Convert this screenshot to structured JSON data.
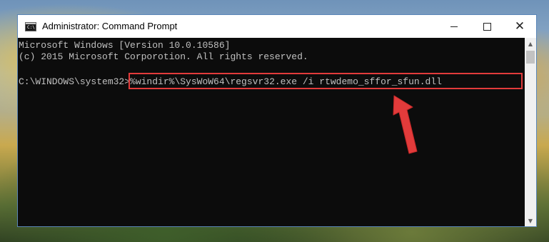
{
  "window": {
    "title": "Administrator: Command Prompt",
    "icon": "cmd-icon",
    "icon_label": "C:\\"
  },
  "controls": {
    "minimize": "minimize-icon",
    "maximize": "maximize-icon",
    "close": "close-icon",
    "close_glyph": "✕"
  },
  "console": {
    "line1": "Microsoft Windows [Version 10.0.10586]",
    "line2": "(c) 2015 Microsoft Corporotion. All rights reserved.",
    "prompt": "C:\\WINDOWS\\system32>",
    "command": "%windir%\\SysWoW64\\regsvr32.exe /i rtwdemo_sffor_sfun.dll"
  },
  "scrollbar": {
    "up_glyph": "▲",
    "down_glyph": "▼"
  },
  "colors": {
    "highlight": "#e23b3b",
    "arrow": "#e23b3b",
    "console_bg": "#0c0c0c",
    "console_text": "#c0c0c0"
  }
}
